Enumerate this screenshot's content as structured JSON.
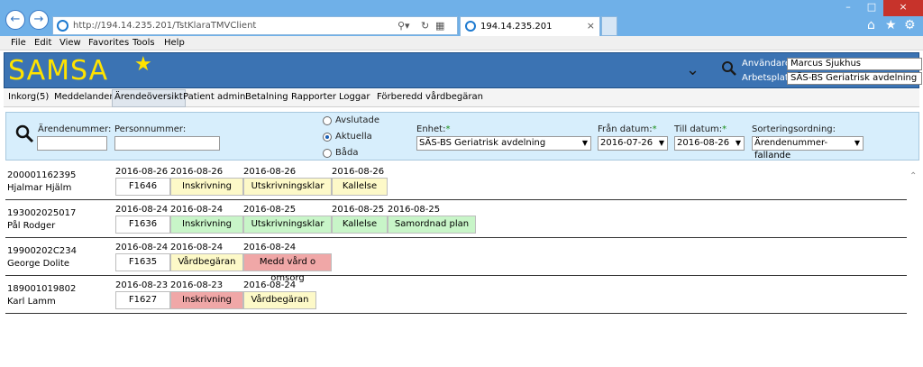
{
  "browser": {
    "url_prefix": "http://194.14.235.201/",
    "url_path": "TstKlaraTMVClient",
    "tab_title": "194.14.235.201"
  },
  "menu": [
    "File",
    "Edit",
    "View",
    "Favorites",
    "Tools",
    "Help"
  ],
  "app": {
    "logo": "SAMSA",
    "user_label": "Användare:",
    "user_value": "Marcus Sjukhus",
    "workplace_label": "Arbetsplats:",
    "workplace_value": "SÄS-BS Geriatrisk avdelning"
  },
  "tabs": [
    "Inkorg(5)",
    "Meddelanden",
    "Ärendeöversikt",
    "Patient admin",
    "Betalning",
    "Rapporter",
    "Loggar",
    "Förberedd vårdbegäran"
  ],
  "active_tab": "Ärendeöversikt",
  "filter": {
    "case_number_label": "Ärendenummer:",
    "personal_number_label": "Personnummer:",
    "radio": [
      "Avslutade",
      "Aktuella",
      "Båda"
    ],
    "radio_selected": "Aktuella",
    "unit_label": "Enhet:",
    "unit_value": "SÄS-BS Geriatrisk avdelning",
    "from_label": "Från datum:",
    "from_value": "2016-07-26",
    "to_label": "Till datum:",
    "to_value": "2016-08-26",
    "sort_label": "Sorteringsordning:",
    "sort_value": "Ärendenummer-fallande",
    "required_mark": "*"
  },
  "colors": {
    "yellow": "#fdf9c8",
    "green": "#c8f5c8",
    "red": "#f0a7a7",
    "white": "#ffffff"
  },
  "cases": [
    {
      "person_id": "200001162395",
      "name": "Hjalmar Hjälm",
      "steps": [
        {
          "date": "2016-08-26",
          "label": "F1646",
          "color": "white"
        },
        {
          "date": "2016-08-26",
          "label": "Inskrivning",
          "color": "yellow"
        },
        {
          "date": "2016-08-26",
          "label": "Utskrivningsklar",
          "color": "yellow"
        },
        {
          "date": "2016-08-26",
          "label": "Kallelse",
          "color": "yellow"
        }
      ]
    },
    {
      "person_id": "193002025017",
      "name": "Pål Rodger",
      "steps": [
        {
          "date": "2016-08-24",
          "label": "F1636",
          "color": "white"
        },
        {
          "date": "2016-08-24",
          "label": "Inskrivning",
          "color": "green"
        },
        {
          "date": "2016-08-25",
          "label": "Utskrivningsklar",
          "color": "green"
        },
        {
          "date": "2016-08-25",
          "label": "Kallelse",
          "color": "green"
        },
        {
          "date": "2016-08-25",
          "label": "Samordnad plan",
          "color": "green"
        }
      ]
    },
    {
      "person_id": "19900202C234",
      "name": "George Dolite",
      "steps": [
        {
          "date": "2016-08-24",
          "label": "F1635",
          "color": "white"
        },
        {
          "date": "2016-08-24",
          "label": "Vårdbegäran",
          "color": "yellow"
        },
        {
          "date": "2016-08-24",
          "label": "Medd vård o omsorg",
          "color": "red"
        }
      ]
    },
    {
      "person_id": "189001019802",
      "name": "Karl Lamm",
      "steps": [
        {
          "date": "2016-08-23",
          "label": "F1627",
          "color": "white"
        },
        {
          "date": "2016-08-23",
          "label": "Inskrivning",
          "color": "red"
        },
        {
          "date": "2016-08-24",
          "label": "Vårdbegäran",
          "color": "yellow"
        }
      ]
    }
  ]
}
